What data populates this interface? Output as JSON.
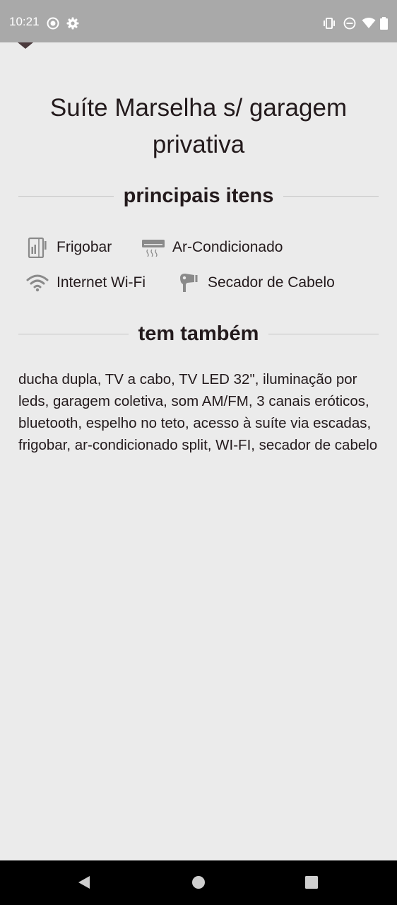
{
  "status_bar": {
    "time": "10:21",
    "left_icons": [
      "record-icon",
      "settings-gear-icon"
    ],
    "right_icons": [
      "vibrate-icon",
      "do-not-disturb-icon",
      "wifi-signal-icon",
      "battery-icon"
    ]
  },
  "header": {
    "dropdown_caret_icon": "caret-down-icon"
  },
  "room": {
    "title": "Suíte Marselha s/ garagem privativa"
  },
  "main_items": {
    "heading": "principais itens",
    "items": [
      {
        "label": "Frigobar",
        "icon": "fridge-icon"
      },
      {
        "label": "Ar-Condicionado",
        "icon": "air-conditioner-icon"
      },
      {
        "label": "Internet Wi-Fi",
        "icon": "wifi-icon"
      },
      {
        "label": "Secador de Cabelo",
        "icon": "hair-dryer-icon"
      }
    ]
  },
  "extras": {
    "heading": "tem também",
    "text": "ducha dupla, TV a cabo, TV LED 32\", iluminação por leds, garagem coletiva, som AM/FM, 3 canais eróticos, bluetooth, espelho no teto, acesso à suíte via escadas, frigobar, ar-condicionado split, WI-FI, secador de cabelo"
  },
  "nav_bar": {
    "buttons": [
      "back-icon",
      "home-icon",
      "recents-icon"
    ]
  },
  "colors": {
    "background": "#ebebeb",
    "status_bar": "#a9a9a9",
    "text": "#231a1c",
    "icon_gray": "#8a8a8a",
    "divider": "#c4c4c4",
    "nav_bar": "#000000"
  }
}
